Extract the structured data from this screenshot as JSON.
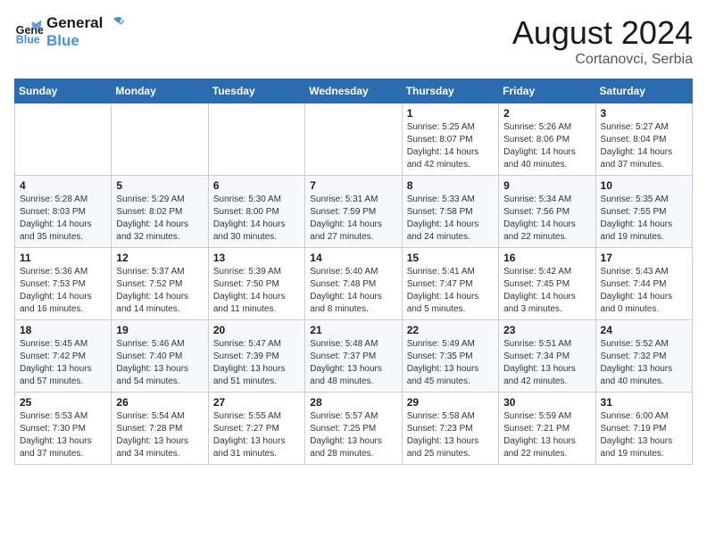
{
  "logo": {
    "line1": "General",
    "line2": "Blue"
  },
  "title": "August 2024",
  "subtitle": "Cortanovci, Serbia",
  "weekdays": [
    "Sunday",
    "Monday",
    "Tuesday",
    "Wednesday",
    "Thursday",
    "Friday",
    "Saturday"
  ],
  "weeks": [
    [
      {
        "day": "",
        "sunrise": "",
        "sunset": "",
        "daylight": ""
      },
      {
        "day": "",
        "sunrise": "",
        "sunset": "",
        "daylight": ""
      },
      {
        "day": "",
        "sunrise": "",
        "sunset": "",
        "daylight": ""
      },
      {
        "day": "",
        "sunrise": "",
        "sunset": "",
        "daylight": ""
      },
      {
        "day": "1",
        "sunrise": "Sunrise: 5:25 AM",
        "sunset": "Sunset: 8:07 PM",
        "daylight": "Daylight: 14 hours and 42 minutes."
      },
      {
        "day": "2",
        "sunrise": "Sunrise: 5:26 AM",
        "sunset": "Sunset: 8:06 PM",
        "daylight": "Daylight: 14 hours and 40 minutes."
      },
      {
        "day": "3",
        "sunrise": "Sunrise: 5:27 AM",
        "sunset": "Sunset: 8:04 PM",
        "daylight": "Daylight: 14 hours and 37 minutes."
      }
    ],
    [
      {
        "day": "4",
        "sunrise": "Sunrise: 5:28 AM",
        "sunset": "Sunset: 8:03 PM",
        "daylight": "Daylight: 14 hours and 35 minutes."
      },
      {
        "day": "5",
        "sunrise": "Sunrise: 5:29 AM",
        "sunset": "Sunset: 8:02 PM",
        "daylight": "Daylight: 14 hours and 32 minutes."
      },
      {
        "day": "6",
        "sunrise": "Sunrise: 5:30 AM",
        "sunset": "Sunset: 8:00 PM",
        "daylight": "Daylight: 14 hours and 30 minutes."
      },
      {
        "day": "7",
        "sunrise": "Sunrise: 5:31 AM",
        "sunset": "Sunset: 7:59 PM",
        "daylight": "Daylight: 14 hours and 27 minutes."
      },
      {
        "day": "8",
        "sunrise": "Sunrise: 5:33 AM",
        "sunset": "Sunset: 7:58 PM",
        "daylight": "Daylight: 14 hours and 24 minutes."
      },
      {
        "day": "9",
        "sunrise": "Sunrise: 5:34 AM",
        "sunset": "Sunset: 7:56 PM",
        "daylight": "Daylight: 14 hours and 22 minutes."
      },
      {
        "day": "10",
        "sunrise": "Sunrise: 5:35 AM",
        "sunset": "Sunset: 7:55 PM",
        "daylight": "Daylight: 14 hours and 19 minutes."
      }
    ],
    [
      {
        "day": "11",
        "sunrise": "Sunrise: 5:36 AM",
        "sunset": "Sunset: 7:53 PM",
        "daylight": "Daylight: 14 hours and 16 minutes."
      },
      {
        "day": "12",
        "sunrise": "Sunrise: 5:37 AM",
        "sunset": "Sunset: 7:52 PM",
        "daylight": "Daylight: 14 hours and 14 minutes."
      },
      {
        "day": "13",
        "sunrise": "Sunrise: 5:39 AM",
        "sunset": "Sunset: 7:50 PM",
        "daylight": "Daylight: 14 hours and 11 minutes."
      },
      {
        "day": "14",
        "sunrise": "Sunrise: 5:40 AM",
        "sunset": "Sunset: 7:48 PM",
        "daylight": "Daylight: 14 hours and 8 minutes."
      },
      {
        "day": "15",
        "sunrise": "Sunrise: 5:41 AM",
        "sunset": "Sunset: 7:47 PM",
        "daylight": "Daylight: 14 hours and 5 minutes."
      },
      {
        "day": "16",
        "sunrise": "Sunrise: 5:42 AM",
        "sunset": "Sunset: 7:45 PM",
        "daylight": "Daylight: 14 hours and 3 minutes."
      },
      {
        "day": "17",
        "sunrise": "Sunrise: 5:43 AM",
        "sunset": "Sunset: 7:44 PM",
        "daylight": "Daylight: 14 hours and 0 minutes."
      }
    ],
    [
      {
        "day": "18",
        "sunrise": "Sunrise: 5:45 AM",
        "sunset": "Sunset: 7:42 PM",
        "daylight": "Daylight: 13 hours and 57 minutes."
      },
      {
        "day": "19",
        "sunrise": "Sunrise: 5:46 AM",
        "sunset": "Sunset: 7:40 PM",
        "daylight": "Daylight: 13 hours and 54 minutes."
      },
      {
        "day": "20",
        "sunrise": "Sunrise: 5:47 AM",
        "sunset": "Sunset: 7:39 PM",
        "daylight": "Daylight: 13 hours and 51 minutes."
      },
      {
        "day": "21",
        "sunrise": "Sunrise: 5:48 AM",
        "sunset": "Sunset: 7:37 PM",
        "daylight": "Daylight: 13 hours and 48 minutes."
      },
      {
        "day": "22",
        "sunrise": "Sunrise: 5:49 AM",
        "sunset": "Sunset: 7:35 PM",
        "daylight": "Daylight: 13 hours and 45 minutes."
      },
      {
        "day": "23",
        "sunrise": "Sunrise: 5:51 AM",
        "sunset": "Sunset: 7:34 PM",
        "daylight": "Daylight: 13 hours and 42 minutes."
      },
      {
        "day": "24",
        "sunrise": "Sunrise: 5:52 AM",
        "sunset": "Sunset: 7:32 PM",
        "daylight": "Daylight: 13 hours and 40 minutes."
      }
    ],
    [
      {
        "day": "25",
        "sunrise": "Sunrise: 5:53 AM",
        "sunset": "Sunset: 7:30 PM",
        "daylight": "Daylight: 13 hours and 37 minutes."
      },
      {
        "day": "26",
        "sunrise": "Sunrise: 5:54 AM",
        "sunset": "Sunset: 7:28 PM",
        "daylight": "Daylight: 13 hours and 34 minutes."
      },
      {
        "day": "27",
        "sunrise": "Sunrise: 5:55 AM",
        "sunset": "Sunset: 7:27 PM",
        "daylight": "Daylight: 13 hours and 31 minutes."
      },
      {
        "day": "28",
        "sunrise": "Sunrise: 5:57 AM",
        "sunset": "Sunset: 7:25 PM",
        "daylight": "Daylight: 13 hours and 28 minutes."
      },
      {
        "day": "29",
        "sunrise": "Sunrise: 5:58 AM",
        "sunset": "Sunset: 7:23 PM",
        "daylight": "Daylight: 13 hours and 25 minutes."
      },
      {
        "day": "30",
        "sunrise": "Sunrise: 5:59 AM",
        "sunset": "Sunset: 7:21 PM",
        "daylight": "Daylight: 13 hours and 22 minutes."
      },
      {
        "day": "31",
        "sunrise": "Sunrise: 6:00 AM",
        "sunset": "Sunset: 7:19 PM",
        "daylight": "Daylight: 13 hours and 19 minutes."
      }
    ]
  ]
}
